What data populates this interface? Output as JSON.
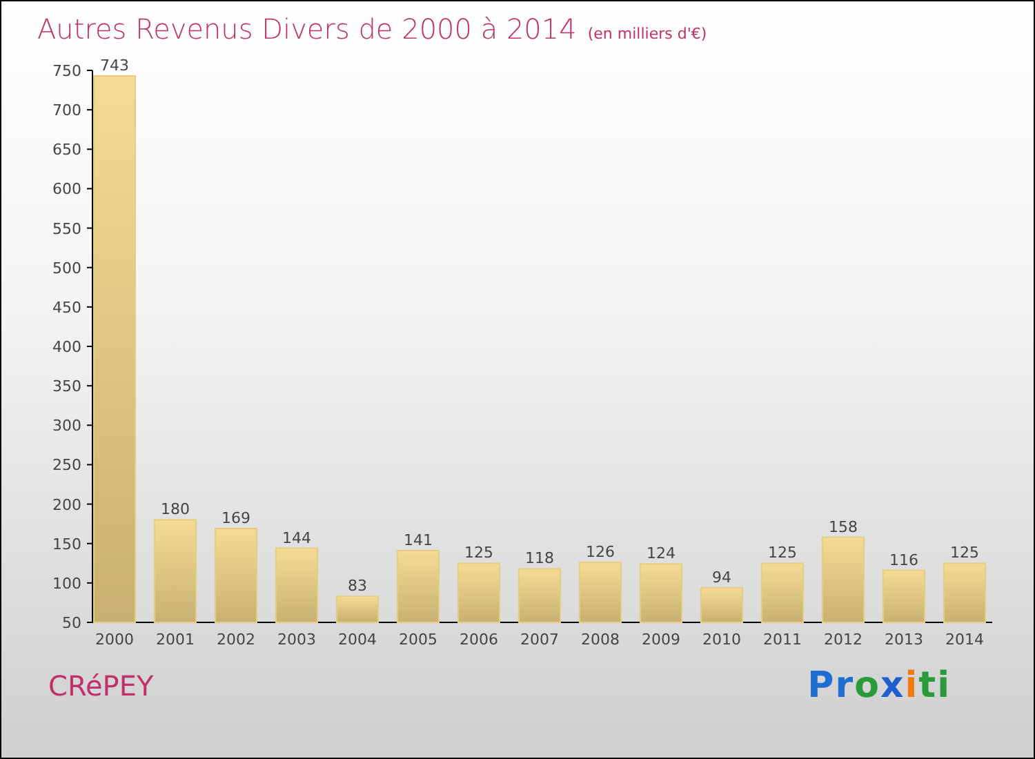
{
  "title": "Autres Revenus Divers de 2000 à 2014",
  "subtitle": "(en milliers d'€)",
  "chart_data": {
    "type": "bar",
    "categories": [
      "2000",
      "2001",
      "2002",
      "2003",
      "2004",
      "2005",
      "2006",
      "2007",
      "2008",
      "2009",
      "2010",
      "2011",
      "2012",
      "2013",
      "2014"
    ],
    "series": [
      {
        "color": "#e6cc80",
        "values": [
          743,
          180,
          169,
          144,
          83,
          141,
          125,
          118,
          126,
          124,
          94,
          125,
          158,
          116,
          125
        ]
      }
    ],
    "ylim": [
      50,
      750
    ],
    "yticks": [
      50,
      100,
      150,
      200,
      250,
      300,
      350,
      400,
      450,
      500,
      550,
      600,
      650,
      700,
      750
    ],
    "data_labels": true
  },
  "place": "CRéPEY",
  "logo": [
    {
      "letter": "P",
      "color": "#1e6fd0"
    },
    {
      "letter": "r",
      "color": "#1e6fd0"
    },
    {
      "letter": "o",
      "color": "#2a9a3a"
    },
    {
      "letter": "x",
      "color": "#1e5fd0"
    },
    {
      "letter": "i",
      "color": "#f07a10"
    },
    {
      "letter": "t",
      "color": "#2a9a3a"
    },
    {
      "letter": "i",
      "color": "#2a9a3a"
    }
  ]
}
